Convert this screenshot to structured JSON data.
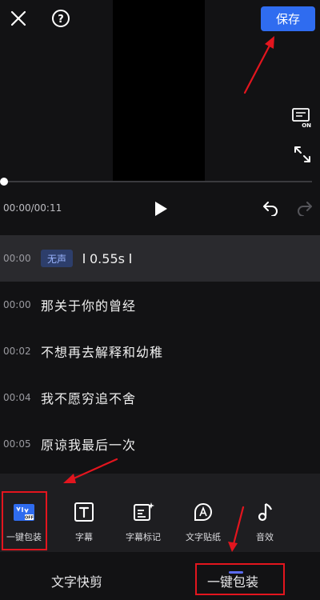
{
  "header": {
    "save_label": "保存"
  },
  "player": {
    "time": "00:00/00:11",
    "progress": 0.0
  },
  "subtitles": [
    {
      "time": "00:00",
      "badge": "无声",
      "duration": "0.55s"
    },
    {
      "time": "00:00",
      "text": "那关于你的曾经"
    },
    {
      "time": "00:02",
      "text": "不想再去解释和幼稚"
    },
    {
      "time": "00:04",
      "text": "我不愿穷追不舍"
    },
    {
      "time": "00:05",
      "text": "原谅我最后一次"
    }
  ],
  "toolbar": {
    "items": [
      {
        "label": "一键包装",
        "icon": "auto-package-icon"
      },
      {
        "label": "字幕",
        "icon": "text-icon"
      },
      {
        "label": "字幕标记",
        "icon": "caption-mark-icon"
      },
      {
        "label": "文字贴纸",
        "icon": "text-sticker-icon"
      },
      {
        "label": "音效",
        "icon": "music-note-icon"
      }
    ]
  },
  "tabs": [
    {
      "label": "文字快剪"
    },
    {
      "label": "一键包装",
      "active": true
    }
  ],
  "colors": {
    "accent": "#2f6cf0",
    "annotation": "#e3151e"
  }
}
